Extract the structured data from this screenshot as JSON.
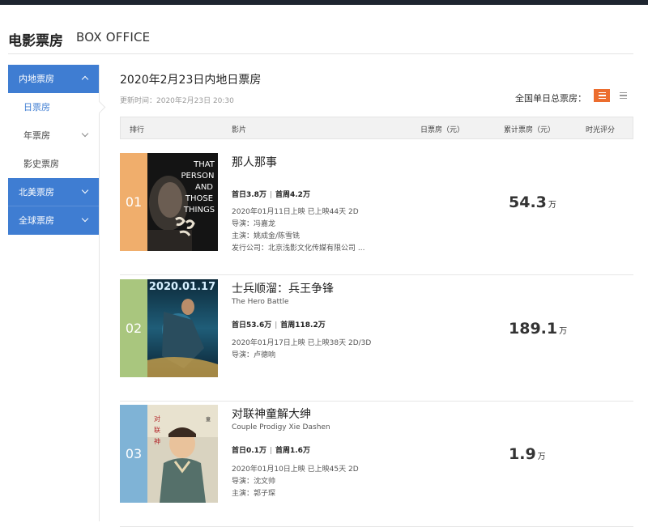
{
  "header": {
    "title_cn": "电影票房",
    "title_en": "BOX OFFICE"
  },
  "sidebar": {
    "items": [
      {
        "label": "内地票房"
      },
      {
        "label": "日票房"
      },
      {
        "label": "年票房"
      },
      {
        "label": "影史票房"
      },
      {
        "label": "北美票房"
      },
      {
        "label": "全球票房"
      }
    ]
  },
  "main": {
    "title": "2020年2月23日内地日票房",
    "update_time": "更新时间：2020年2月23日 20:30",
    "view_toggle_label": "全国单日总票房："
  },
  "table": {
    "columns": [
      "排行",
      "影片",
      "日票房（元）",
      "累计票房（元）",
      "时光评分"
    ]
  },
  "films": [
    {
      "rank": "01",
      "title": "那人那事",
      "title_en": "",
      "first_day": "首日3.8万",
      "first_week": "首周4.2万",
      "release": "2020年01月11日上映 已上映44天 2D",
      "director": "导演：冯嘉龙",
      "cast": "主演：姚成金/陈雪铣",
      "distributor": "发行公司：北京浅影文化传媒有限公司 ...",
      "total": "54.3",
      "unit": "万",
      "poster_text": [
        "THAT",
        "PERSON",
        "AND",
        "THOSE",
        "THINGS"
      ],
      "rank_color": "#f0ae6c"
    },
    {
      "rank": "02",
      "title": "士兵顺溜：兵王争锋",
      "title_en": "The Hero Battle",
      "first_day": "首日53.6万",
      "first_week": "首周118.2万",
      "release": "2020年01月17日上映 已上映38天 2D/3D",
      "director": "导演：卢德响",
      "total": "189.1",
      "unit": "万",
      "poster_text": [
        "2020.01.17"
      ],
      "rank_color": "#a9c67e"
    },
    {
      "rank": "03",
      "title": "对联神童解大绅",
      "title_en": "Couple Prodigy Xie Dashen",
      "first_day": "首日0.1万",
      "first_week": "首周1.6万",
      "release": "2020年01月10日上映 已上映45天 2D",
      "director": "导演：沈文帅",
      "cast": "主演：郭子琛",
      "total": "1.9",
      "unit": "万",
      "rank_color": "#7fb3d6"
    }
  ],
  "colors": {
    "accent_blue": "#3f7dd2",
    "accent_orange": "#ec6d2e"
  }
}
